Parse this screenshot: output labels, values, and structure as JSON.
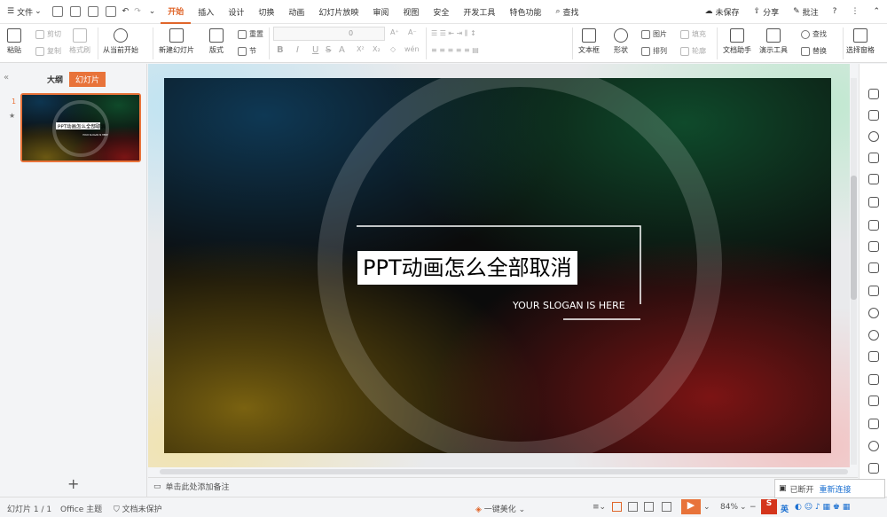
{
  "menubar": {
    "file": "文件",
    "items": [
      "开始",
      "插入",
      "设计",
      "切换",
      "动画",
      "幻灯片放映",
      "审阅",
      "视图",
      "安全",
      "开发工具",
      "特色功能"
    ],
    "active": "开始",
    "search": "查找",
    "unsaved": "未保存",
    "share": "分享",
    "comment": "批注",
    "help": "?"
  },
  "ribbon": {
    "paste": "粘贴",
    "cut": "剪切",
    "copy": "复制",
    "format_painter": "格式刷",
    "from_current": "从当前开始",
    "new_slide": "新建幻灯片",
    "layout": "版式",
    "reset": "重置",
    "section": "节",
    "font_size": "0",
    "bold": "B",
    "italic": "I",
    "underline": "U",
    "strike": "S",
    "font_color": "A",
    "superscript": "X²",
    "subscript": "X₂",
    "textbox": "文本框",
    "shape": "形状",
    "picture": "图片",
    "arrange": "排列",
    "fill": "填充",
    "outline": "轮廓",
    "doc_assistant": "文档助手",
    "present_tools": "演示工具",
    "find": "查找",
    "replace": "替换",
    "select_pane": "选择窗格"
  },
  "panel": {
    "tab_outline": "大纲",
    "tab_slides": "幻灯片",
    "slide_number": "1",
    "add": "+"
  },
  "slide": {
    "title": "PPT动画怎么全部取消",
    "slogan": "YOUR SLOGAN IS HERE"
  },
  "thumb": {
    "title": "PPT动画怎么全部取消",
    "slogan": "YOUR SLOGAN IS HERE"
  },
  "notes": {
    "placeholder": "单击此处添加备注"
  },
  "status": {
    "slide_info": "幻灯片 1 / 1",
    "theme": "Office 主题",
    "protect": "文档未保护",
    "beautify": "一键美化",
    "zoom": "84%",
    "ime": "英",
    "popup_text": "已断开",
    "reconnect": "重新连接"
  },
  "colors": {
    "accent": "#e0662b"
  }
}
